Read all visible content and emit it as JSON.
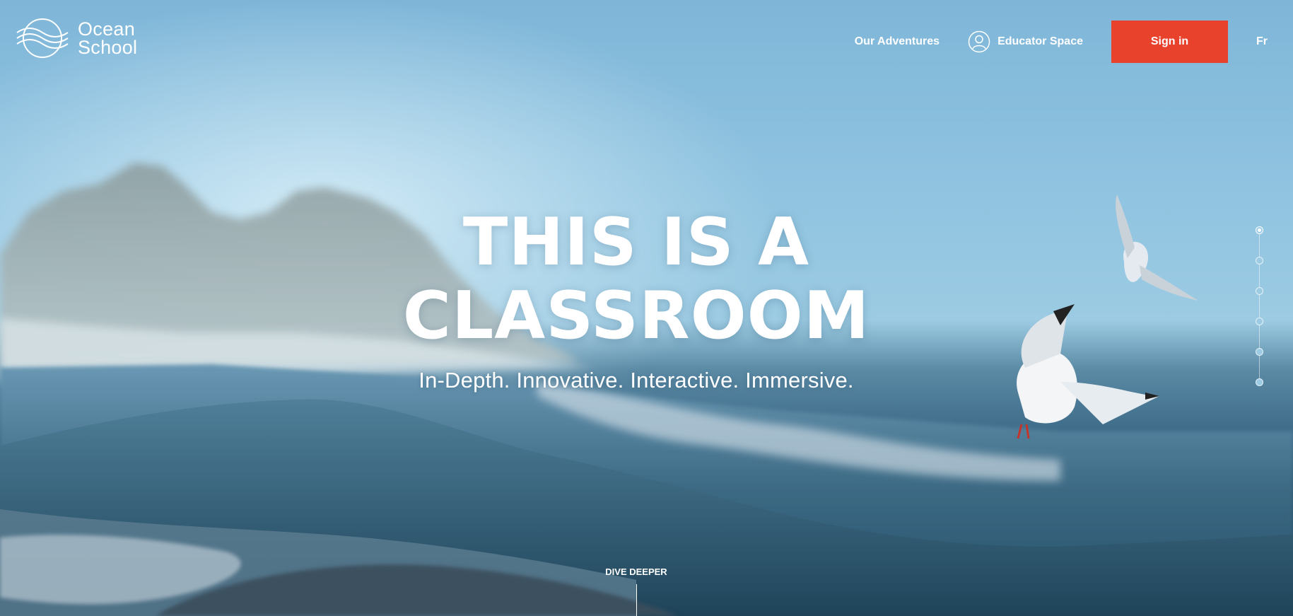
{
  "brand": {
    "name_line1": "Ocean",
    "name_line2": "School"
  },
  "nav": {
    "adventures_label": "Our Adventures",
    "educator_label": "Educator Space",
    "signin_label": "Sign in",
    "language_label": "Fr"
  },
  "hero": {
    "headline_line1": "THIS IS A",
    "headline_line2": "CLASSROOM",
    "tagline": "In-Depth. Innovative. Interactive. Immersive."
  },
  "scroll": {
    "dive_label": "DIVE DEEPER"
  },
  "pager": {
    "total_sections": 6,
    "active_section": 1
  },
  "colors": {
    "accent": "#e8412c",
    "sky": "#8fc3e0",
    "water": "#2e5873",
    "text": "#ffffff"
  },
  "icons": {
    "logo": "ocean-waves-logo-icon",
    "educator": "user-circle-icon"
  }
}
